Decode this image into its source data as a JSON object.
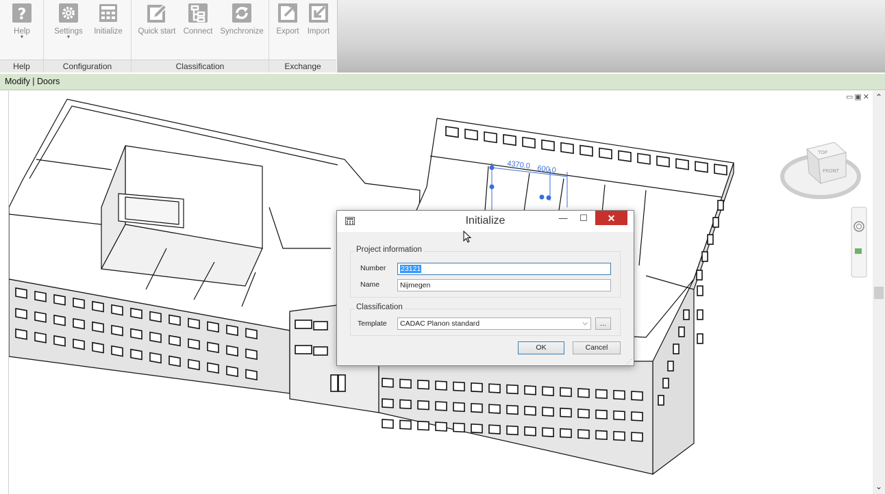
{
  "ribbon": {
    "panels": [
      {
        "title": "Help",
        "buttons": [
          {
            "label": "Help",
            "icon": "help-icon",
            "dropdown": true
          }
        ]
      },
      {
        "title": "Configuration",
        "buttons": [
          {
            "label": "Settings",
            "icon": "gear-icon",
            "dropdown": true
          },
          {
            "label": "Initialize",
            "icon": "calculator-icon"
          }
        ]
      },
      {
        "title": "Classification",
        "buttons": [
          {
            "label": "Quick start",
            "icon": "edit-icon"
          },
          {
            "label": "Connect",
            "icon": "tree-icon"
          },
          {
            "label": "Synchronize",
            "icon": "sync-icon"
          }
        ]
      },
      {
        "title": "Exchange",
        "buttons": [
          {
            "label": "Export",
            "icon": "export-icon"
          },
          {
            "label": "Import",
            "icon": "import-icon"
          }
        ]
      }
    ]
  },
  "context_bar": {
    "label": "Modify | Doors"
  },
  "viewport": {
    "viewcube_faces": {
      "top": "TOP",
      "front": "FRONT"
    },
    "dimensions": [
      "4370.0",
      "600.0"
    ]
  },
  "dialog": {
    "title": "Initialize",
    "close_glyph": "✕",
    "project_group": {
      "title": "Project information",
      "number_label": "Number",
      "number_value": "23121",
      "name_label": "Name",
      "name_value": "Nijmegen"
    },
    "classification_group": {
      "title": "Classification",
      "template_label": "Template",
      "template_value": "CADAC Planon standard",
      "browse_label": "..."
    },
    "ok_label": "OK",
    "cancel_label": "Cancel"
  },
  "colors": {
    "context_bar": "#d8e6cf",
    "close_button": "#c7312b",
    "selection": "#3399ff",
    "dimension": "#3a6fd8"
  }
}
